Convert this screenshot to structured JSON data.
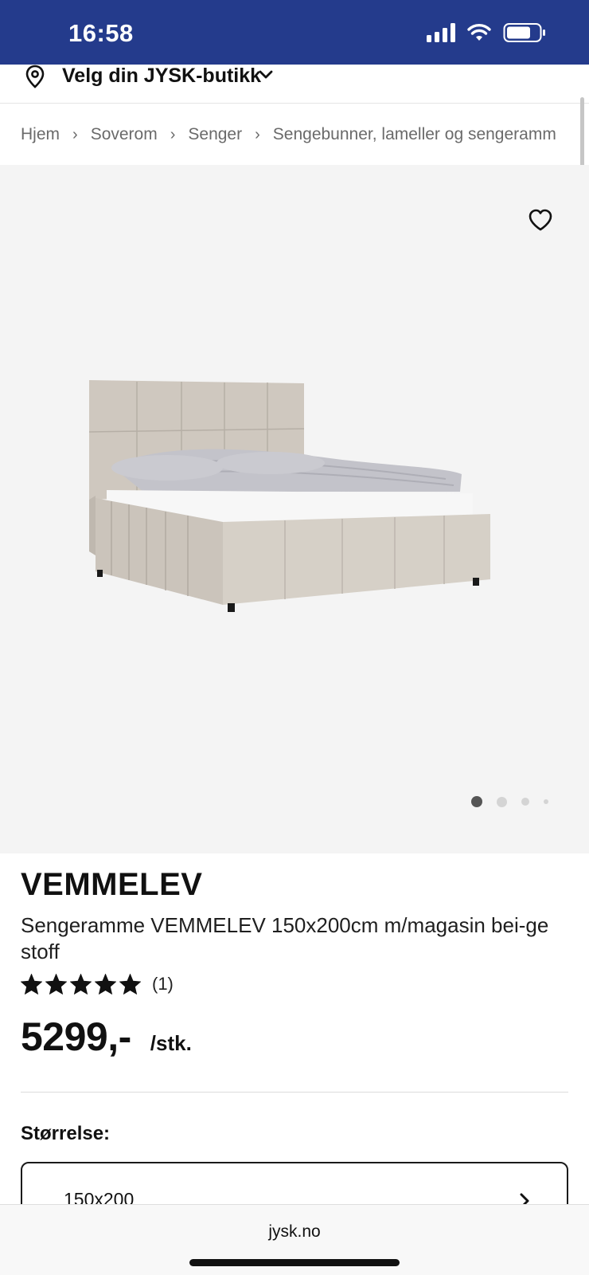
{
  "status_bar": {
    "time": "16:58",
    "battery_level": 0.75
  },
  "store_selector": {
    "label": "Velg din JYSK-butikk"
  },
  "breadcrumb": {
    "items": [
      "Hjem",
      "Soverom",
      "Senger",
      "Sengebunner, lameller og sengeramm"
    ],
    "separator": "›"
  },
  "carousel": {
    "count": 4,
    "active_index": 0
  },
  "product": {
    "brand": "VEMMELEV",
    "name": "Sengeramme VEMMELEV 150x200cm m/magasin bei-ge stoff",
    "rating": {
      "stars": 5,
      "max_stars": 5,
      "count_text": "(1)"
    },
    "price": "5299,-",
    "unit": "/stk.",
    "size_label": "Størrelse:",
    "size_value": "150x200"
  },
  "browser": {
    "url": "jysk.no"
  },
  "colors": {
    "header_blue": "#243b8c",
    "media_bg": "#f4f4f4",
    "text": "#111111"
  }
}
